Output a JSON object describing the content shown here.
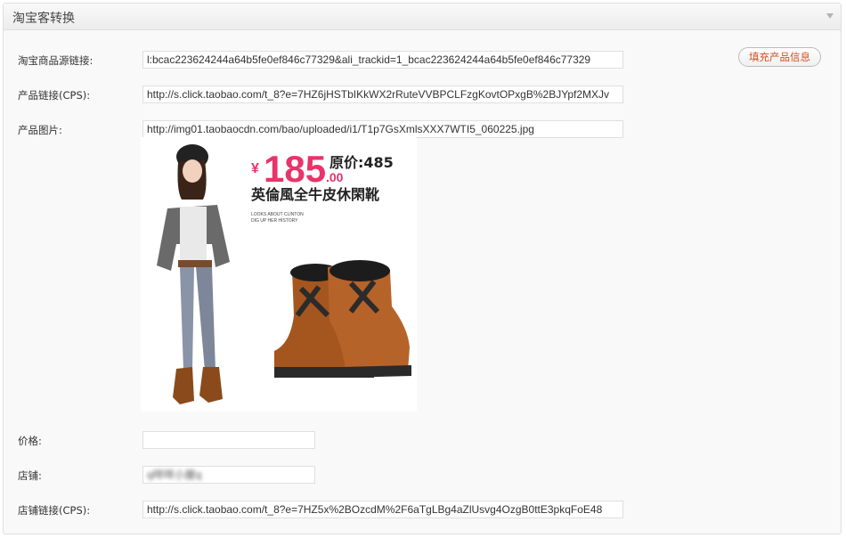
{
  "panel": {
    "title": "淘宝客转换"
  },
  "fields": {
    "source_link": {
      "label": "淘宝商品源链接:",
      "value": "l:bcac223624244a64b5fe0ef846c77329&ali_trackid=1_bcac223624244a64b5fe0ef846c77329"
    },
    "product_link": {
      "label": "产品链接(CPS):",
      "value": "http://s.click.taobao.com/t_8?e=7HZ6jHSTbIKkWX2rRuteVVBPCLFzgKovtOPxgB%2BJYpf2MXJv"
    },
    "product_image": {
      "label": "产品图片:",
      "value": "http://img01.taobaocdn.com/bao/uploaded/i1/T1p7GsXmlsXXX7WTI5_060225.jpg"
    },
    "price": {
      "label": "价格:",
      "value": ""
    },
    "shop": {
      "label": "店铺:",
      "value": "q咩咩小屋q"
    },
    "shop_link": {
      "label": "店铺链接(CPS):",
      "value": "http://s.click.taobao.com/t_8?e=7HZ5x%2BOzcdM%2F6aTgLBg4aZlUsvg4OzgB0ttE3pkqFoE48"
    }
  },
  "fill_button": {
    "label": "填充产品信息"
  },
  "product_image_content": {
    "price_currency": "¥",
    "price_main": "185",
    "price_decimal": ".00",
    "original_price": "原价:485",
    "product_name": "英倫風全牛皮休閑靴",
    "tagline_1": "LOOKS ABOUT CLINTON",
    "tagline_2": "DIG UP HER HISTORY"
  }
}
